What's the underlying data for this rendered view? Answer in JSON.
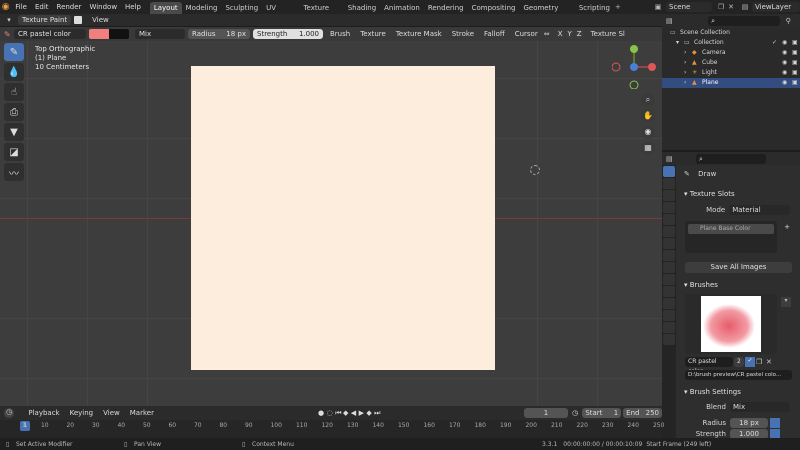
{
  "menu": [
    "File",
    "Edit",
    "Render",
    "Window",
    "Help"
  ],
  "workspaces": [
    "Layout",
    "Modeling",
    "Sculpting",
    "UV Editing",
    "Texture Paint",
    "Shading",
    "Animation",
    "Rendering",
    "Compositing",
    "Geometry Nodes",
    "Scripting"
  ],
  "active_workspace": "Layout",
  "scene": {
    "label": "Scene",
    "view_layer": "ViewLayer"
  },
  "header": {
    "mode": "Texture Paint",
    "view": "View"
  },
  "toolhdr": {
    "brush_name": "CR pastel color",
    "blend": "Mix",
    "radius_label": "Radius",
    "radius_value": "18 px",
    "strength_label": "Strength",
    "strength_value": "1.000",
    "dropdowns": [
      "Brush",
      "Texture",
      "Texture Mask",
      "Stroke",
      "Falloff",
      "Cursor"
    ],
    "texture_slots": "Texture Sl",
    "xyz": [
      "X",
      "Y",
      "Z"
    ]
  },
  "viewport_info": [
    "Top Orthographic",
    "(1) Plane",
    "10 Centimeters"
  ],
  "outliner": {
    "root": "Scene Collection",
    "collection": "Collection",
    "items": [
      "Camera",
      "Cube",
      "Light",
      "Plane"
    ]
  },
  "props": {
    "tool": "Draw",
    "texture_slots": "Texture Slots",
    "mode_label": "Mode",
    "mode_value": "Material",
    "slot": "Plane Base Color",
    "save_all": "Save All Images",
    "brushes": "Brushes",
    "brush_name": "CR pastel color",
    "brush_users": "2",
    "brush_path": "D:\\brush preview\\CR pastel colo...",
    "brush_settings": "Brush Settings",
    "blend_label": "Blend",
    "blend_value": "Mix",
    "radius_label": "Radius",
    "radius_value": "18 px",
    "strength_label": "Strength",
    "strength_value": "1.000"
  },
  "timeline": {
    "menus": [
      "Playback",
      "Keying",
      "View",
      "Marker"
    ],
    "current": "1",
    "start_label": "Start",
    "start": "1",
    "end_label": "End",
    "end": "250"
  },
  "ruler_ticks": [
    "1",
    "10",
    "20",
    "30",
    "40",
    "50",
    "60",
    "70",
    "80",
    "90",
    "100",
    "110",
    "120",
    "130",
    "140",
    "150",
    "160",
    "170",
    "180",
    "190",
    "200",
    "210",
    "220",
    "230",
    "240",
    "250"
  ],
  "status": {
    "left": "Set Active Modifier",
    "mid": "Pan View",
    "right": "Context Menu",
    "version": "3.3.1",
    "time": "00:00:00:00 / 00:00:10:09",
    "frame": "Start Frame (249 left)"
  },
  "colors": {
    "accent": "#4772b3",
    "canvas": "#fdeddc",
    "brush_color": "#f08080"
  }
}
